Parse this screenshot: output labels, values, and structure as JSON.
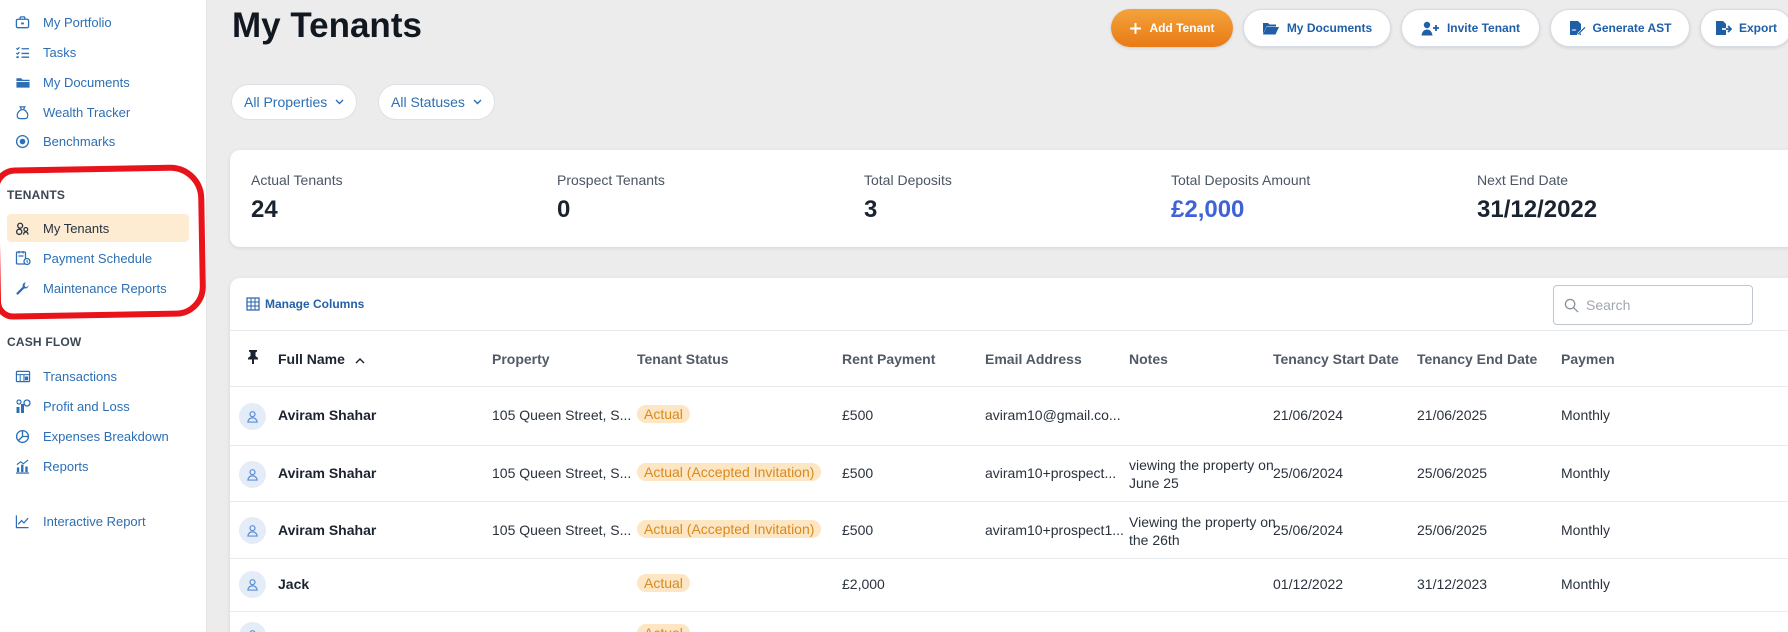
{
  "sidebar": {
    "top_items": [
      {
        "label": "My Portfolio",
        "icon": "briefcase-icon"
      },
      {
        "label": "Tasks",
        "icon": "checklist-icon"
      },
      {
        "label": "My Documents",
        "icon": "folder-icon"
      },
      {
        "label": "Wealth Tracker",
        "icon": "money-bag-icon"
      },
      {
        "label": "Benchmarks",
        "icon": "benchmark-icon"
      }
    ],
    "tenants_header": "TENANTS",
    "tenants_items": [
      {
        "label": "My Tenants",
        "icon": "tenants-icon",
        "active": true
      },
      {
        "label": "Payment Schedule",
        "icon": "payment-schedule-icon"
      },
      {
        "label": "Maintenance Reports",
        "icon": "wrench-icon"
      }
    ],
    "cashflow_header": "CASH FLOW",
    "cashflow_items": [
      {
        "label": "Transactions",
        "icon": "transactions-icon"
      },
      {
        "label": "Profit and Loss",
        "icon": "profit-loss-icon"
      },
      {
        "label": "Expenses Breakdown",
        "icon": "pie-chart-icon"
      },
      {
        "label": "Reports",
        "icon": "reports-icon"
      }
    ],
    "extra_items": [
      {
        "label": "Interactive Report",
        "icon": "line-chart-icon"
      }
    ]
  },
  "header": {
    "title": "My Tenants",
    "buttons": {
      "add_tenant": "Add Tenant",
      "my_documents": "My Documents",
      "invite_tenant": "Invite Tenant",
      "generate_ast": "Generate AST",
      "export": "Export"
    }
  },
  "filters": {
    "properties": "All Properties",
    "statuses": "All Statuses"
  },
  "stats": [
    {
      "label": "Actual Tenants",
      "value": "24"
    },
    {
      "label": "Prospect Tenants",
      "value": "0"
    },
    {
      "label": "Total Deposits",
      "value": "3"
    },
    {
      "label": "Total Deposits Amount",
      "value": "£2,000"
    },
    {
      "label": "Next End Date",
      "value": "31/12/2022"
    }
  ],
  "table": {
    "manage_columns": "Manage Columns",
    "search_placeholder": "Search",
    "columns": {
      "full_name": "Full Name",
      "property": "Property",
      "tenant_status": "Tenant Status",
      "rent_payment": "Rent Payment",
      "email": "Email Address",
      "notes": "Notes",
      "start": "Tenancy Start Date",
      "end": "Tenancy End Date",
      "payment": "Paymen"
    },
    "sort": {
      "column": "Full Name",
      "direction": "ascending"
    },
    "rows": [
      {
        "name": "Aviram Shahar",
        "property": "105 Queen Street, S...",
        "status": "Actual",
        "rent": "£500",
        "email": "aviram10@gmail.co...",
        "notes": "",
        "start": "21/06/2024",
        "end": "21/06/2025",
        "payment": "Monthly"
      },
      {
        "name": "Aviram Shahar",
        "property": "105 Queen Street, S...",
        "status": "Actual (Accepted Invitation)",
        "rent": "£500",
        "email": "aviram10+prospect...",
        "notes": "viewing the property on June 25",
        "start": "25/06/2024",
        "end": "25/06/2025",
        "payment": "Monthly"
      },
      {
        "name": "Aviram Shahar",
        "property": "105 Queen Street, S...",
        "status": "Actual (Accepted Invitation)",
        "rent": "£500",
        "email": "aviram10+prospect1...",
        "notes": "Viewing the property on the 26th",
        "start": "25/06/2024",
        "end": "25/06/2025",
        "payment": "Monthly"
      },
      {
        "name": "Jack",
        "property": "",
        "status": "Actual",
        "rent": "£2,000",
        "email": "",
        "notes": "",
        "start": "01/12/2022",
        "end": "31/12/2023",
        "payment": "Monthly"
      },
      {
        "name": "",
        "property": "",
        "status": "Actual",
        "rent": "",
        "email": "",
        "notes": "",
        "start": "",
        "end": "",
        "payment": ""
      }
    ]
  },
  "colors": {
    "accent_orange": "#e97a16",
    "link_blue": "#2c6fb5",
    "active_bg": "#fdecd2",
    "badge_bg": "#fde6c4",
    "badge_text": "#d88a1e",
    "amount_blue": "#3f63d6",
    "annotation_red": "#e8141a"
  }
}
